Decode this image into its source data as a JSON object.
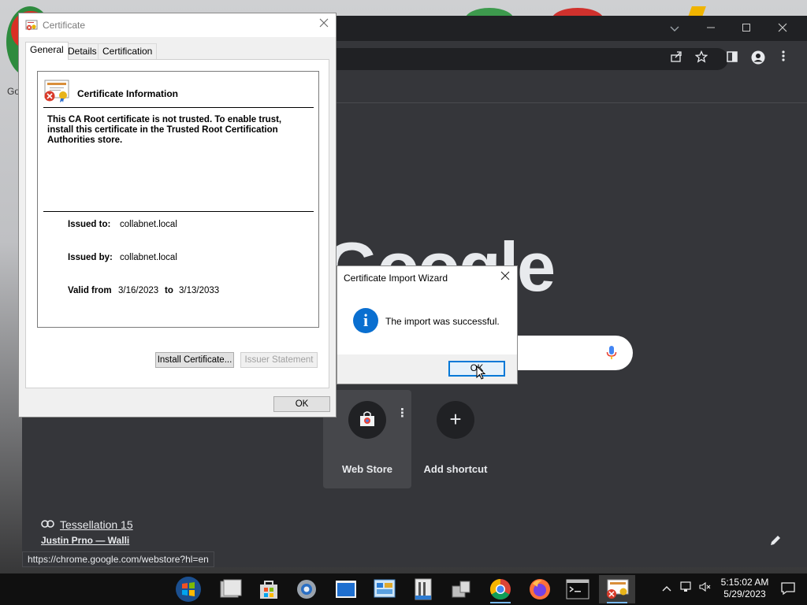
{
  "certificate_dialog": {
    "title": "Certificate",
    "tabs": [
      {
        "label": "General",
        "active": true
      },
      {
        "label": "Details",
        "active": false
      },
      {
        "label": "Certification Path",
        "active": false
      }
    ],
    "heading": "Certificate Information",
    "warning_text": "This CA Root certificate is not trusted. To enable trust, install this certificate in the Trusted Root Certification Authorities store.",
    "issued_to_label": "Issued to:",
    "issued_to_value": "collabnet.local",
    "issued_by_label": "Issued by:",
    "issued_by_value": "collabnet.local",
    "valid_from_label": "Valid from",
    "valid_from_value": "3/16/2023",
    "valid_to_label": "to",
    "valid_to_value": "3/13/2033",
    "install_button": "Install Certificate...",
    "issuer_statement_button": "Issuer Statement",
    "ok_button": "OK"
  },
  "import_wizard": {
    "title": "Certificate Import Wizard",
    "message": "The import was successful.",
    "ok_button": "OK"
  },
  "chrome": {
    "logo_text": "Google",
    "shortcuts": [
      {
        "label": "Web Store"
      },
      {
        "label": "Add shortcut"
      }
    ],
    "wallpaper_title": "Tessellation 15",
    "wallpaper_author": "Justin Prno — Walli",
    "status_url": "https://chrome.google.com/webstore?hl=en",
    "desktop_label": "Go"
  },
  "taskbar": {
    "time": "5:15:02 AM",
    "date": "5/29/2023"
  },
  "colors": {
    "chrome_bg": "#35363a",
    "chrome_titlebar": "#202124",
    "accent_blue": "#0078d7",
    "info_blue": "#0a6fd0"
  }
}
